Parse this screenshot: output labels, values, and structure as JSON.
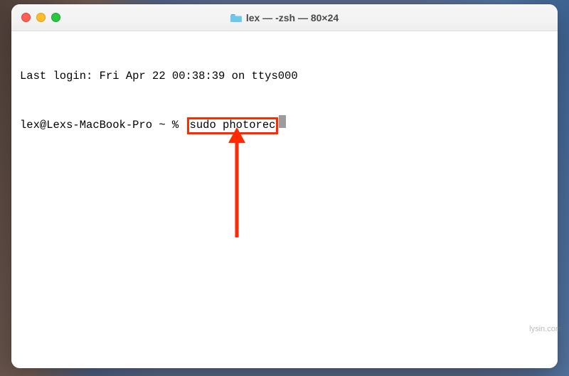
{
  "window": {
    "title": "lex — -zsh — 80×24"
  },
  "terminal": {
    "last_login": "Last login: Fri Apr 22 00:38:39 on ttys000",
    "prompt": "lex@Lexs-MacBook-Pro ~ % ",
    "command": "sudo photorec"
  },
  "annotation": {
    "color": "#ff2a00"
  },
  "watermark": "lysin.com"
}
